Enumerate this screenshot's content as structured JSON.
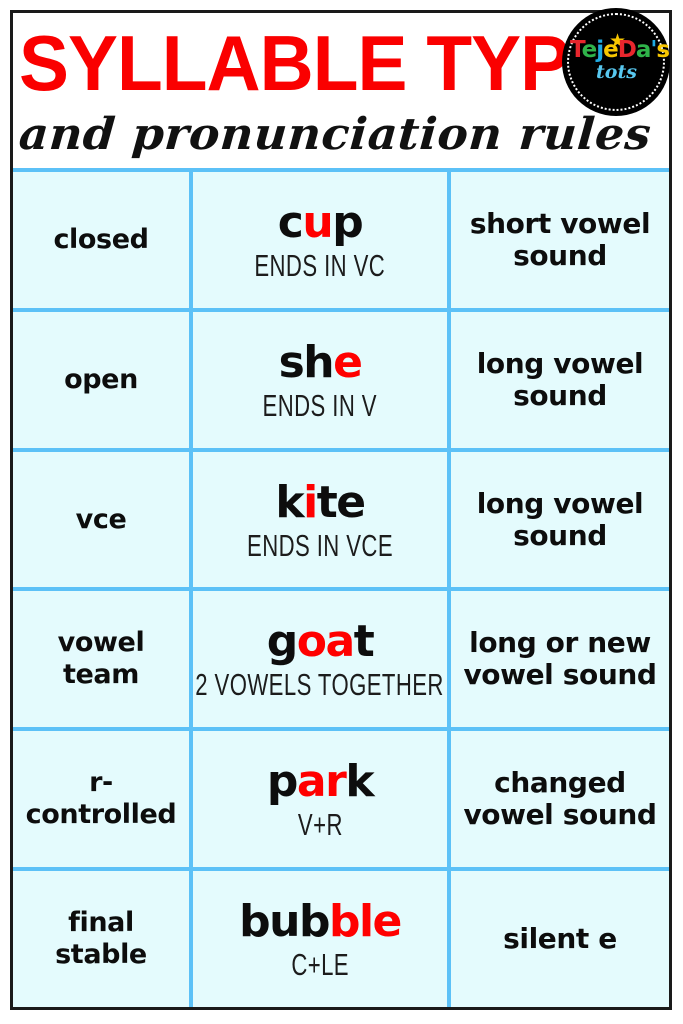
{
  "poster": {
    "title": "SYLLABLE TYPES",
    "subtitle": "and pronunciation rules",
    "title_color": "#fa0000",
    "cell_background": "#e4fbfd",
    "grid_line_color": "#5cc1f7",
    "frame_color": "#1a1a1a",
    "highlight_color": "#ff0000"
  },
  "logo": {
    "brand_part1": "Te",
    "brand_part2": "je",
    "brand_part3": "Da",
    "brand_part4": "'s",
    "brand_sub": "tots",
    "star": "★",
    "letters": [
      "T",
      "e",
      "j",
      "e",
      "D",
      "a",
      "'",
      "s"
    ]
  },
  "table": {
    "rows": [
      {
        "type": "closed",
        "word_prefix": "c",
        "word_highlight": "u",
        "word_suffix": "p",
        "rule": "ENDS IN VC",
        "sound": "short vowel sound"
      },
      {
        "type": "open",
        "word_prefix": "sh",
        "word_highlight": "e",
        "word_suffix": "",
        "rule": "ENDS IN V",
        "sound": "long vowel sound"
      },
      {
        "type": "vce",
        "word_prefix": "k",
        "word_highlight": "i",
        "word_suffix": "te",
        "rule": "ENDS IN VCE",
        "sound": "long vowel sound"
      },
      {
        "type": "vowel team",
        "word_prefix": "g",
        "word_highlight": "oa",
        "word_suffix": "t",
        "rule": "2 VOWELS TOGETHER",
        "sound": "long or new vowel sound"
      },
      {
        "type": "r-controlled",
        "word_prefix": "p",
        "word_highlight": "ar",
        "word_suffix": "k",
        "rule": "V+R",
        "sound": "changed vowel sound"
      },
      {
        "type": "final stable",
        "word_prefix": "bub",
        "word_highlight": "ble",
        "word_suffix": "",
        "rule": "C+LE",
        "sound": "silent e"
      }
    ]
  }
}
